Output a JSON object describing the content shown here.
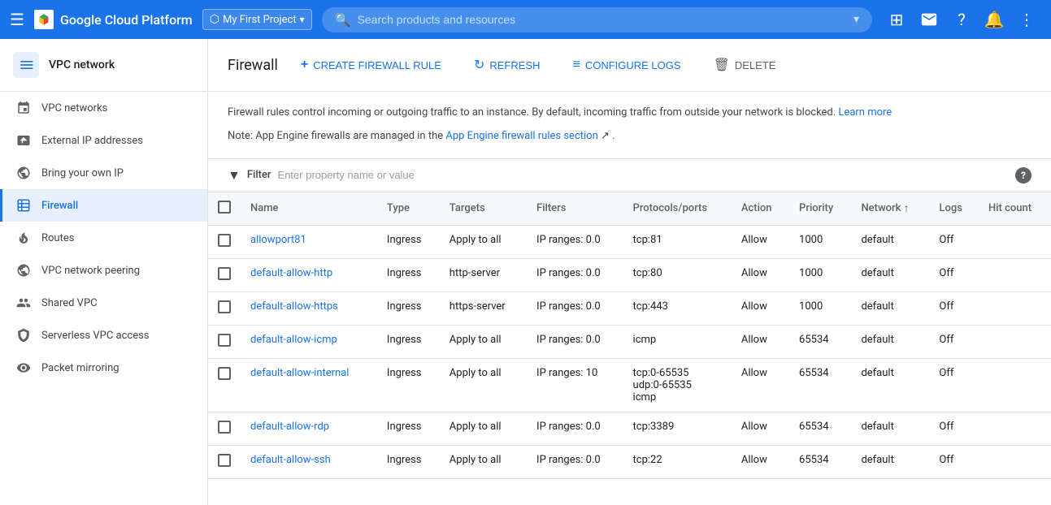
{
  "topbar": {
    "menu_label": "☰",
    "logo_text": "Google Cloud Platform",
    "project_icon": "⬡",
    "project_name": "My First Project",
    "project_dropdown": "▾",
    "search_placeholder": "Search products and resources",
    "search_expand": "▾",
    "icons": {
      "apps": "⊞",
      "support": "💬",
      "help": "?",
      "bell": "🔔",
      "more": "⋮"
    }
  },
  "sidebar": {
    "header_title": "VPC network",
    "items": [
      {
        "id": "vpc-networks",
        "label": "VPC networks",
        "active": false
      },
      {
        "id": "external-ip",
        "label": "External IP addresses",
        "active": false
      },
      {
        "id": "bring-your-own",
        "label": "Bring your own IP",
        "active": false
      },
      {
        "id": "firewall",
        "label": "Firewall",
        "active": true
      },
      {
        "id": "routes",
        "label": "Routes",
        "active": false
      },
      {
        "id": "peering",
        "label": "VPC network peering",
        "active": false
      },
      {
        "id": "shared-vpc",
        "label": "Shared VPC",
        "active": false
      },
      {
        "id": "serverless",
        "label": "Serverless VPC access",
        "active": false
      },
      {
        "id": "packet-mirroring",
        "label": "Packet mirroring",
        "active": false
      }
    ],
    "collapse_label": "‹"
  },
  "page": {
    "title": "Firewall",
    "toolbar": {
      "create_label": "CREATE FIREWALL RULE",
      "refresh_label": "REFRESH",
      "configure_label": "CONFIGURE LOGS",
      "delete_label": "DELETE"
    },
    "info": {
      "text1": "Firewall rules control incoming or outgoing traffic to an instance. By default, incoming traffic from outside your network is blocked.",
      "learn_more": "Learn more",
      "text2": "Note: App Engine firewalls are managed in the",
      "app_engine_link": "App Engine firewall rules section",
      "text3": "."
    },
    "filter": {
      "label": "Filter",
      "placeholder": "Enter property name or value"
    },
    "table": {
      "columns": [
        "",
        "Name",
        "Type",
        "Targets",
        "Filters",
        "Protocols/ports",
        "Action",
        "Priority",
        "Network",
        "Logs",
        "Hit count"
      ],
      "rows": [
        {
          "name": "allowport81",
          "type": "Ingress",
          "targets": "Apply to all",
          "filters": "IP ranges: 0.0",
          "protocols": "tcp:81",
          "action": "Allow",
          "priority": "1000",
          "network": "default",
          "logs": "Off",
          "hit_count": ""
        },
        {
          "name": "default-allow-http",
          "type": "Ingress",
          "targets": "http-server",
          "filters": "IP ranges: 0.0",
          "protocols": "tcp:80",
          "action": "Allow",
          "priority": "1000",
          "network": "default",
          "logs": "Off",
          "hit_count": ""
        },
        {
          "name": "default-allow-https",
          "type": "Ingress",
          "targets": "https-server",
          "filters": "IP ranges: 0.0",
          "protocols": "tcp:443",
          "action": "Allow",
          "priority": "1000",
          "network": "default",
          "logs": "Off",
          "hit_count": ""
        },
        {
          "name": "default-allow-icmp",
          "type": "Ingress",
          "targets": "Apply to all",
          "filters": "IP ranges: 0.0",
          "protocols": "icmp",
          "action": "Allow",
          "priority": "65534",
          "network": "default",
          "logs": "Off",
          "hit_count": ""
        },
        {
          "name": "default-allow-internal",
          "type": "Ingress",
          "targets": "Apply to all",
          "filters": "IP ranges: 10",
          "protocols": "tcp:0-65535\nudp:0-65535\nicmp",
          "action": "Allow",
          "priority": "65534",
          "network": "default",
          "logs": "Off",
          "hit_count": ""
        },
        {
          "name": "default-allow-rdp",
          "type": "Ingress",
          "targets": "Apply to all",
          "filters": "IP ranges: 0.0",
          "protocols": "tcp:3389",
          "action": "Allow",
          "priority": "65534",
          "network": "default",
          "logs": "Off",
          "hit_count": ""
        },
        {
          "name": "default-allow-ssh",
          "type": "Ingress",
          "targets": "Apply to all",
          "filters": "IP ranges: 0.0",
          "protocols": "tcp:22",
          "action": "Allow",
          "priority": "65534",
          "network": "default",
          "logs": "Off",
          "hit_count": ""
        }
      ]
    }
  }
}
